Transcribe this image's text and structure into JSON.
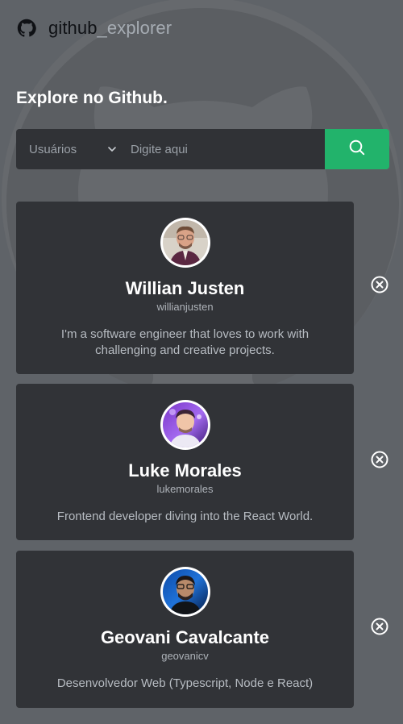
{
  "app": {
    "name_primary": "github",
    "name_accent": "_explorer"
  },
  "page": {
    "title": "Explore no Github."
  },
  "search": {
    "filter_selected": "Usuários",
    "placeholder": "Digite aqui",
    "value": ""
  },
  "colors": {
    "background": "#5f6368",
    "card": "#313337",
    "search_button": "#22b36b"
  },
  "icons": {
    "logo": "github-icon",
    "filter": "chevron-down-icon",
    "search": "search-icon",
    "remove": "close-circle-icon"
  },
  "users": [
    {
      "name": "Willian Justen",
      "username": "willianjusten",
      "bio": "I'm a software engineer that loves to work with challenging and creative projects."
    },
    {
      "name": "Luke Morales",
      "username": "lukemorales",
      "bio": "Frontend developer diving into the React World."
    },
    {
      "name": "Geovani Cavalcante",
      "username": "geovanicv",
      "bio": "Desenvolvedor Web (Typescript, Node e React)"
    }
  ]
}
